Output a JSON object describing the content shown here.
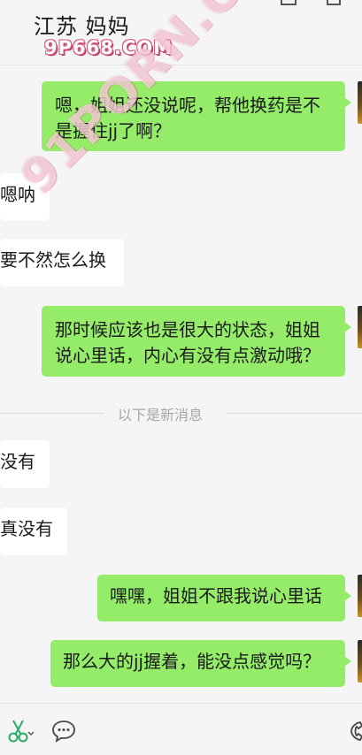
{
  "header": {
    "title": "江苏  妈妈",
    "watermark": "9P668.COM"
  },
  "watermark_diagonal": "91PORN.COM",
  "messages": [
    {
      "side": "out",
      "text_line1": "嗯，姐姐还没说呢，帮他换药是不",
      "text_line2": "是握住jj了啊？"
    },
    {
      "side": "in",
      "text": "嗯呐"
    },
    {
      "side": "in",
      "text": "要不然怎么换"
    },
    {
      "side": "out",
      "text_line1": "那时候应该也是很大的状态，姐姐",
      "text_line2": "说心里话，内心有没有点激动哦？"
    },
    {
      "side": "in",
      "text": "没有"
    },
    {
      "side": "in",
      "text": "真没有"
    },
    {
      "side": "out",
      "text": "嘿嘿，姐姐不跟我说心里话"
    },
    {
      "side": "out",
      "text": "那么大的jj握着，能没点感觉吗？"
    }
  ],
  "divider_text": "以下是新消息",
  "footer": {
    "icons": [
      "scissors-icon",
      "chat-bubble-icon",
      "phone-icon"
    ]
  },
  "colors": {
    "bubble_out": "#95ec69",
    "bubble_in": "#ffffff",
    "background": "#f5f5f5",
    "icon_accent": "#2aae67"
  }
}
